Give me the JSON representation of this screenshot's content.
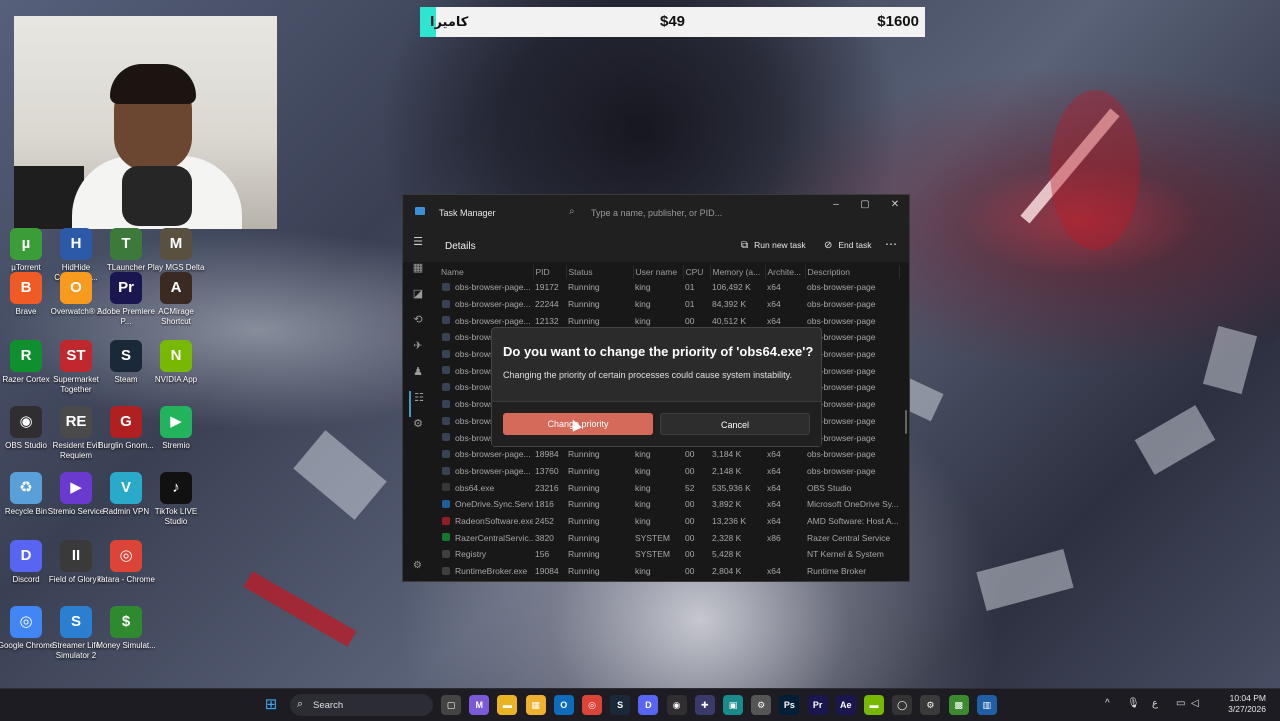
{
  "donation_bar": {
    "item": "كاميرا",
    "current": "$49",
    "goal": "$1600",
    "progress": 0.031
  },
  "webcam": {
    "label": "webcam-feed"
  },
  "desktop_icons": [
    {
      "label": "µTorrent",
      "icon": "utorrent-icon",
      "color": "#3a9d38",
      "glyph": "µ"
    },
    {
      "label": "HidHide Configurat...",
      "icon": "hidhide-icon",
      "color": "#2d5aa8",
      "glyph": "H"
    },
    {
      "label": "TLauncher",
      "icon": "tlauncher-icon",
      "color": "#3b7a3a",
      "glyph": "T"
    },
    {
      "label": "Play MGS Delta Sna...",
      "icon": "mgs-icon",
      "color": "#5a5040",
      "glyph": "M"
    },
    {
      "label": "Brave",
      "icon": "brave-icon",
      "color": "#f05a24",
      "glyph": "B"
    },
    {
      "label": "Overwatch® 2",
      "icon": "overwatch-icon",
      "color": "#f89a1e",
      "glyph": "O"
    },
    {
      "label": "Adobe Premiere P...",
      "icon": "premiere-icon",
      "color": "#1a1650",
      "glyph": "Pr"
    },
    {
      "label": "ACMirage Shortcut",
      "icon": "acmirage-icon",
      "color": "#3b2a22",
      "glyph": "A"
    },
    {
      "label": "Razer Cortex",
      "icon": "razer-cortex-icon",
      "color": "#0f8f2e",
      "glyph": "R"
    },
    {
      "label": "Supermarket Together",
      "icon": "supermarket-icon",
      "color": "#c0282e",
      "glyph": "ST"
    },
    {
      "label": "Steam",
      "icon": "steam-icon",
      "color": "#1b2838",
      "glyph": "S"
    },
    {
      "label": "NVIDIA App",
      "icon": "nvidia-icon",
      "color": "#76b900",
      "glyph": "N"
    },
    {
      "label": "OBS Studio",
      "icon": "obs-icon",
      "color": "#302e31",
      "glyph": "◉"
    },
    {
      "label": "Resident Evil Requiem",
      "icon": "resident-evil-icon",
      "color": "#4a4a4a",
      "glyph": "RE"
    },
    {
      "label": "Burglin Gnom...",
      "icon": "burglin-icon",
      "color": "#b02020",
      "glyph": "G"
    },
    {
      "label": "Stremio",
      "icon": "stremio-icon",
      "color": "#22b35d",
      "glyph": "▶"
    },
    {
      "label": "Recycle Bin",
      "icon": "recycle-bin-icon",
      "color": "#5aa0d8",
      "glyph": "♻"
    },
    {
      "label": "Stremio Service",
      "icon": "stremio-service-icon",
      "color": "#6a3ad0",
      "glyph": "▶"
    },
    {
      "label": "Radmin VPN",
      "icon": "radmin-icon",
      "color": "#2aa9c8",
      "glyph": "V"
    },
    {
      "label": "TikTok LIVE Studio",
      "icon": "tiktok-icon",
      "color": "#111111",
      "glyph": "♪"
    },
    {
      "label": "Discord",
      "icon": "discord-icon",
      "color": "#5865f2",
      "glyph": "D"
    },
    {
      "label": "Field of Glory II",
      "icon": "field-of-glory-icon",
      "color": "#3a3a3a",
      "glyph": "II"
    },
    {
      "label": "katara - Chrome",
      "icon": "chrome-katara-icon",
      "color": "#db4437",
      "glyph": "◎"
    },
    {
      "label": "Google Chrome",
      "icon": "chrome-icon",
      "color": "#4285f4",
      "glyph": "◎"
    },
    {
      "label": "Streamer Life Simulator 2",
      "icon": "streamer-life-icon",
      "color": "#2a7fd0",
      "glyph": "S"
    },
    {
      "label": "Money Simulat...",
      "icon": "money-sim-icon",
      "color": "#2f8a2f",
      "glyph": "$"
    }
  ],
  "task_manager": {
    "title": "Task Manager",
    "search_placeholder": "Type a name, publisher, or PID...",
    "section_title": "Details",
    "run_new_task": "Run new task",
    "end_task": "End task",
    "columns": [
      "Name",
      "PID",
      "Status",
      "User name",
      "CPU",
      "Memory (a...",
      "Archite...",
      "Description"
    ],
    "rows": [
      [
        "obs-browser-page...",
        "19172",
        "Running",
        "king",
        "01",
        "106,492 K",
        "x64",
        "obs-browser-page"
      ],
      [
        "obs-browser-page...",
        "22244",
        "Running",
        "king",
        "01",
        "84,392 K",
        "x64",
        "obs-browser-page"
      ],
      [
        "obs-browser-page...",
        "12132",
        "Running",
        "king",
        "00",
        "40,512 K",
        "x64",
        "obs-browser-page"
      ],
      [
        "obs-browser-page...",
        "",
        "",
        "",
        "",
        "",
        "",
        "obs-browser-page"
      ],
      [
        "obs-browser-page...",
        "",
        "",
        "",
        "",
        "",
        "",
        "obs-browser-page"
      ],
      [
        "obs-browser-page...",
        "",
        "",
        "",
        "",
        "",
        "",
        "obs-browser-page"
      ],
      [
        "obs-browser-page...",
        "",
        "",
        "",
        "",
        "",
        "",
        "obs-browser-page"
      ],
      [
        "obs-browser-page...",
        "",
        "",
        "",
        "",
        "",
        "",
        "obs-browser-page"
      ],
      [
        "obs-browser-page...",
        "",
        "",
        "",
        "",
        "",
        "",
        "obs-browser-page"
      ],
      [
        "obs-browser-page...",
        "",
        "",
        "",
        "",
        "",
        "",
        "obs-browser-page"
      ],
      [
        "obs-browser-page...",
        "18984",
        "Running",
        "king",
        "00",
        "3,184 K",
        "x64",
        "obs-browser-page"
      ],
      [
        "obs-browser-page...",
        "13760",
        "Running",
        "king",
        "00",
        "2,148 K",
        "x64",
        "obs-browser-page"
      ],
      [
        "obs64.exe",
        "23216",
        "Running",
        "king",
        "52",
        "535,936 K",
        "x64",
        "OBS Studio"
      ],
      [
        "OneDrive.Sync.Servi...",
        "1816",
        "Running",
        "king",
        "00",
        "3,892 K",
        "x64",
        "Microsoft OneDrive Sy..."
      ],
      [
        "RadeonSoftware.exe",
        "2452",
        "Running",
        "king",
        "00",
        "13,236 K",
        "x64",
        "AMD Software: Host A..."
      ],
      [
        "RazerCentralServic...",
        "3820",
        "Running",
        "SYSTEM",
        "00",
        "2,328 K",
        "x86",
        "Razer Central Service"
      ],
      [
        "Registry",
        "156",
        "Running",
        "SYSTEM",
        "00",
        "5,428 K",
        "",
        "NT Kernel & System"
      ],
      [
        "RuntimeBroker.exe",
        "19084",
        "Running",
        "king",
        "00",
        "2,804 K",
        "x64",
        "Runtime Broker"
      ]
    ]
  },
  "dialog": {
    "question": "Do you want to change the priority of 'obs64.exe'?",
    "warning": "Changing the priority of certain processes could cause system instability.",
    "confirm": "Change priority",
    "cancel": "Cancel"
  },
  "taskbar": {
    "search": "Search",
    "apps": [
      {
        "icon": "task-view-icon",
        "color": "#444444",
        "glyph": "▢"
      },
      {
        "icon": "m365-icon",
        "color": "#7b5ad8",
        "glyph": "M"
      },
      {
        "icon": "file-explorer-icon",
        "color": "#e8b422",
        "glyph": "▬"
      },
      {
        "icon": "store-icon",
        "color": "#f0b030",
        "glyph": "▦"
      },
      {
        "icon": "outlook-icon",
        "color": "#0f6cbd",
        "glyph": "O"
      },
      {
        "icon": "chrome-taskbar-icon",
        "color": "#db4437",
        "glyph": "◎"
      },
      {
        "icon": "steam-taskbar-icon",
        "color": "#1b2838",
        "glyph": "S"
      },
      {
        "icon": "discord-taskbar-icon",
        "color": "#5865f2",
        "glyph": "D"
      },
      {
        "icon": "obs-taskbar-icon",
        "color": "#302e31",
        "glyph": "◉"
      },
      {
        "icon": "controller-icon",
        "color": "#3a3a6a",
        "glyph": "✚"
      },
      {
        "icon": "capcut-icon",
        "color": "#1a8a8a",
        "glyph": "▣"
      },
      {
        "icon": "settings-taskbar-icon",
        "color": "#555555",
        "glyph": "⚙"
      },
      {
        "icon": "photoshop-icon",
        "color": "#001e36",
        "glyph": "Ps"
      },
      {
        "icon": "premiere-taskbar-icon",
        "color": "#1a1650",
        "glyph": "Pr"
      },
      {
        "icon": "after-effects-icon",
        "color": "#1a1650",
        "glyph": "Ae"
      },
      {
        "icon": "nvidia-taskbar-icon",
        "color": "#76b900",
        "glyph": "▬"
      },
      {
        "icon": "github-icon",
        "color": "#333333",
        "glyph": "◯"
      },
      {
        "icon": "gear-taskbar-icon",
        "color": "#3a3a3a",
        "glyph": "⚙"
      },
      {
        "icon": "minecraft-icon",
        "color": "#3c8a2e",
        "glyph": "▩"
      },
      {
        "icon": "task-manager-taskbar-icon",
        "color": "#1f5fa8",
        "glyph": "▥"
      }
    ],
    "lang": "ع",
    "time": "10:04 PM",
    "date": "3/27/2026"
  }
}
